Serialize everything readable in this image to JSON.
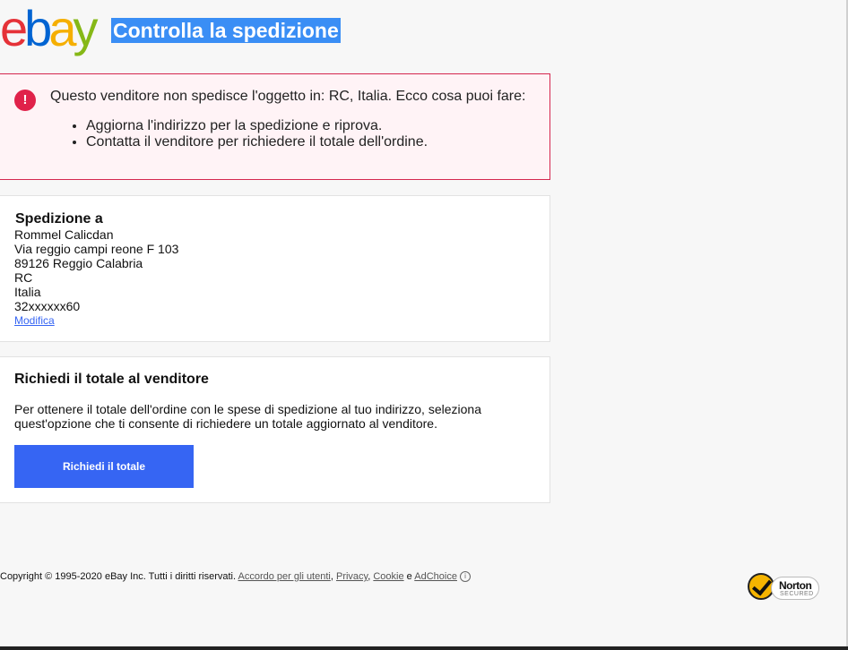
{
  "header": {
    "logo": {
      "e": "e",
      "b": "b",
      "a": "a",
      "y": "y"
    },
    "title": "Controlla la spedizione"
  },
  "alert": {
    "icon": "!",
    "message": "Questo venditore non spedisce l'oggetto in: RC, Italia. Ecco cosa puoi fare:",
    "items": [
      "Aggiorna l'indirizzo per la spedizione e riprova.",
      "Contatta il venditore per richiedere il totale dell'ordine."
    ]
  },
  "shipping": {
    "title": "Spedizione a",
    "lines": [
      "Rommel Calicdan",
      "Via reggio campi reone F 103",
      "89126 Reggio Calabria",
      "RC",
      "Italia",
      "32xxxxxx60"
    ],
    "edit_label": "Modifica"
  },
  "request": {
    "title": "Richiedi il totale al venditore",
    "description": "Per ottenere il totale dell'ordine con le spese di spedizione al tuo indirizzo, seleziona quest'opzione che ti consente di richiedere un totale aggiornato al venditore.",
    "button_label": "Richiedi il totale"
  },
  "footer": {
    "copyright": "Copyright © 1995-2020 eBay Inc. Tutti i diritti riservati.",
    "links": [
      "Accordo per gli utenti",
      "Privacy",
      "Cookie",
      "AdChoice"
    ],
    "sep1": ",",
    "sep2": ",",
    "conj": "e",
    "info_icon": "i"
  },
  "norton": {
    "name": "Norton",
    "sub": "SECURED"
  },
  "colors": {
    "primary": "#3665f3",
    "alert_border": "#d5264e",
    "alert_bg": "#fff3f6",
    "title_highlight": "#3a8ef5"
  },
  "icons": [
    "alert-icon",
    "info-icon",
    "norton-check-icon"
  ]
}
